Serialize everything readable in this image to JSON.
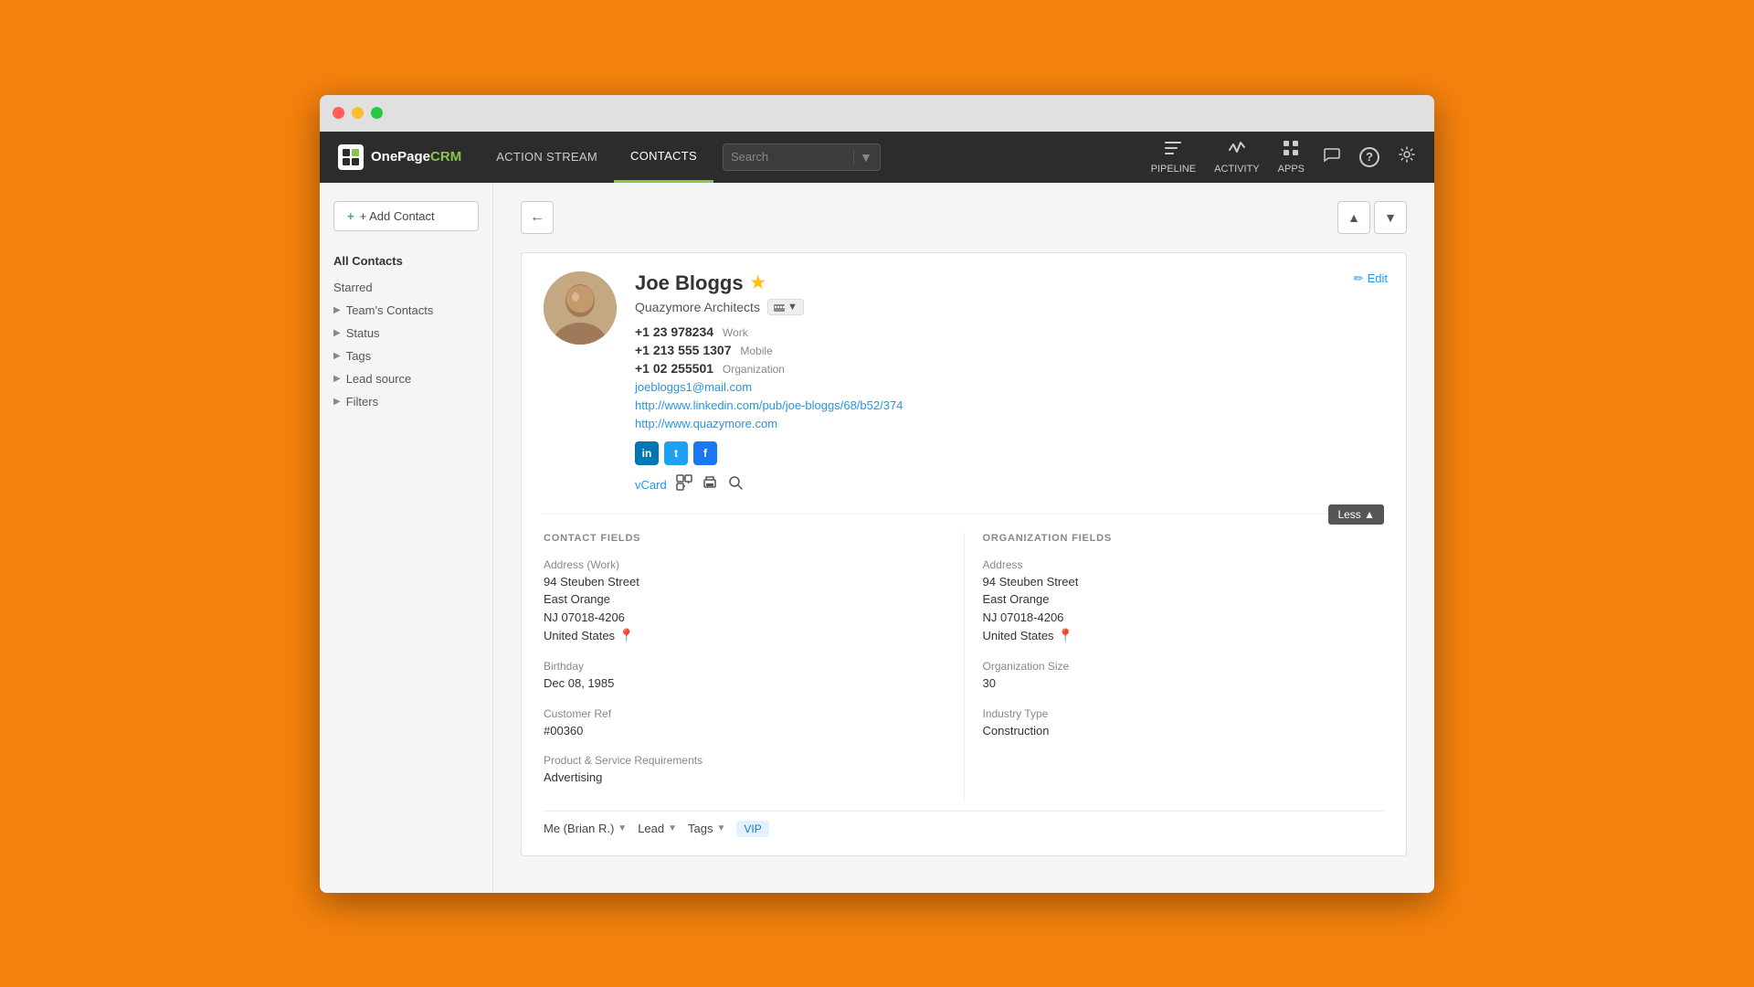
{
  "window": {
    "title": "OnePageCRM"
  },
  "navbar": {
    "brand": "OnePageCRM",
    "nav_items": [
      {
        "id": "action-stream",
        "label": "ACTION STREAM",
        "active": false
      },
      {
        "id": "contacts",
        "label": "CONTACTS",
        "active": true
      }
    ],
    "search_placeholder": "Search",
    "icons": [
      {
        "id": "pipeline",
        "glyph": "⬡",
        "label": "PIPELINE"
      },
      {
        "id": "activity",
        "glyph": "⚡",
        "label": "ACTIVITY"
      },
      {
        "id": "apps",
        "glyph": "⊞",
        "label": "APPS"
      },
      {
        "id": "messages",
        "glyph": "💬",
        "label": ""
      },
      {
        "id": "help",
        "glyph": "?",
        "label": ""
      },
      {
        "id": "settings",
        "glyph": "⚙",
        "label": ""
      }
    ]
  },
  "sidebar": {
    "add_contact_label": "+ Add Contact",
    "all_contacts_label": "All Contacts",
    "items": [
      {
        "id": "starred",
        "label": "Starred"
      },
      {
        "id": "teams-contacts",
        "label": "Team's Contacts"
      },
      {
        "id": "status",
        "label": "Status"
      },
      {
        "id": "tags",
        "label": "Tags"
      },
      {
        "id": "lead-source",
        "label": "Lead source"
      },
      {
        "id": "filters",
        "label": "Filters"
      }
    ]
  },
  "contact": {
    "name": "Joe Bloggs",
    "company": "Quazymore Architects",
    "phone_work": "+1 23 978234",
    "phone_work_label": "Work",
    "phone_mobile": "+1 213 555 1307",
    "phone_mobile_label": "Mobile",
    "phone_org": "+1 02 255501",
    "phone_org_label": "Organization",
    "email": "joebloggs1@mail.com",
    "linkedin_url": "http://www.linkedin.com/pub/joe-bloggs/68/b52/374",
    "website_url": "http://www.quazymore.com",
    "vcard_label": "vCard",
    "edit_label": "✏ Edit",
    "less_label": "Less ▲",
    "fields": {
      "contact_header": "CONTACT FIELDS",
      "address_label": "Address (Work)",
      "address_line1": "94 Steuben Street",
      "address_line2": "East Orange",
      "address_line3": "NJ 07018-4206",
      "address_country": "United States",
      "birthday_label": "Birthday",
      "birthday_value": "Dec 08, 1985",
      "customer_ref_label": "Customer Ref",
      "customer_ref_value": "#00360",
      "product_label": "Product & Service Requirements",
      "product_value": "Advertising"
    },
    "org_fields": {
      "org_header": "ORGANIZATION FIELDS",
      "address_label": "Address",
      "address_line1": "94 Steuben Street",
      "address_line2": "East Orange",
      "address_line3": "NJ 07018-4206",
      "address_country": "United States",
      "org_size_label": "Organization Size",
      "org_size_value": "30",
      "industry_label": "Industry Type",
      "industry_value": "Construction"
    },
    "bottom": {
      "owner_label": "Me (Brian R.)",
      "lead_label": "Lead",
      "tags_label": "Tags",
      "tag_vip": "VIP"
    }
  }
}
